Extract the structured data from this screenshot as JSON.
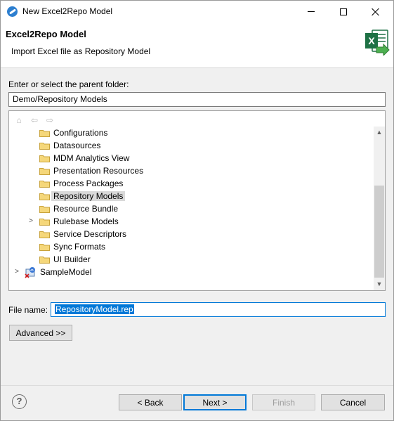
{
  "window": {
    "title": "New Excel2Repo Model"
  },
  "banner": {
    "title": "Excel2Repo Model",
    "subtitle": "Import Excel file as Repository Model"
  },
  "parent_folder": {
    "label": "Enter or select the parent folder:",
    "value": "Demo/Repository Models"
  },
  "tree": {
    "items": [
      {
        "label": "Configurations",
        "icon": "folder-icon",
        "expandable": false,
        "selected": false
      },
      {
        "label": "Datasources",
        "icon": "folder-icon",
        "expandable": false,
        "selected": false
      },
      {
        "label": "MDM Analytics View",
        "icon": "folder-icon",
        "expandable": false,
        "selected": false
      },
      {
        "label": "Presentation Resources",
        "icon": "folder-icon",
        "expandable": false,
        "selected": false
      },
      {
        "label": "Process Packages",
        "icon": "folder-icon",
        "expandable": false,
        "selected": false
      },
      {
        "label": "Repository Models",
        "icon": "folder-icon",
        "expandable": false,
        "selected": true
      },
      {
        "label": "Resource Bundle",
        "icon": "folder-icon",
        "expandable": false,
        "selected": false
      },
      {
        "label": "Rulebase Models",
        "icon": "folder-icon",
        "expandable": true,
        "selected": false
      },
      {
        "label": "Service Descriptors",
        "icon": "folder-icon",
        "expandable": false,
        "selected": false
      },
      {
        "label": "Sync Formats",
        "icon": "folder-icon",
        "expandable": false,
        "selected": false
      },
      {
        "label": "UI Builder",
        "icon": "folder-icon",
        "expandable": false,
        "selected": false
      },
      {
        "label": "SampleModel",
        "icon": "project-icon",
        "expandable": true,
        "selected": false
      }
    ]
  },
  "file_name": {
    "label": "File name:",
    "value": "RepositoryModel.rep"
  },
  "buttons": {
    "advanced": "Advanced >>",
    "back": "< Back",
    "next": "Next >",
    "finish": "Finish",
    "cancel": "Cancel",
    "help": "?"
  },
  "colors": {
    "accent": "#0078d7",
    "excel_green": "#1e7145",
    "folder": "#e8c15a"
  }
}
